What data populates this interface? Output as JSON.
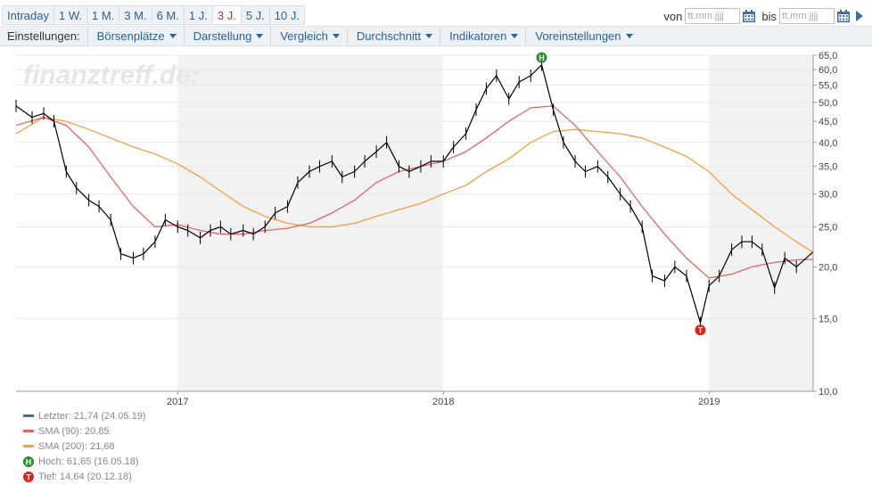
{
  "toolbar": {
    "ranges": [
      "Intraday",
      "1 W.",
      "1 M.",
      "3 M.",
      "6 M.",
      "1 J.",
      "3 J.",
      "5 J.",
      "10 J."
    ],
    "active_range": "3 J.",
    "from_label": "von",
    "to_label": "bis",
    "date_placeholder": "tt.mm.jjjj"
  },
  "settings": {
    "label": "Einstellungen:",
    "menus": [
      "Börsenplätze",
      "Darstellung",
      "Vergleich",
      "Durchschnitt",
      "Indikatoren",
      "Voreinstellungen"
    ]
  },
  "watermark": "finanztreff.de:",
  "colors": {
    "price": "#000000",
    "sma90": "#e06666",
    "sma200": "#f0a040",
    "last": "#3d6fa8",
    "high": "#2e8b2e",
    "low": "#d9251d",
    "shade": "#f2f2f2",
    "grid": "#e8e8e8"
  },
  "legend": [
    {
      "text": "Letzter: 21,74 (24.05.19)",
      "kind": "line",
      "color": "#3d6fa8"
    },
    {
      "text": "SMA (90): 20,85",
      "kind": "line",
      "color": "#e06666"
    },
    {
      "text": "SMA (200): 21,68",
      "kind": "line",
      "color": "#f0a040"
    },
    {
      "text": "Hoch: 61,65 (16.05.18)",
      "kind": "marker",
      "letter": "H",
      "color": "#2e8b2e"
    },
    {
      "text": "Tief: 14,64 (20.12.18)",
      "kind": "marker",
      "letter": "T",
      "color": "#d9251d"
    }
  ],
  "chart_data": {
    "type": "line",
    "y_scale": "log",
    "ylim": [
      10,
      65
    ],
    "yticks": [
      10,
      15,
      20,
      25,
      30,
      35,
      40,
      45,
      50,
      55,
      60,
      65
    ],
    "ytick_labels": [
      "10,0",
      "15,0",
      "20,0",
      "25,0",
      "30,0",
      "35,0",
      "40,0",
      "45,0",
      "50,0",
      "55,0",
      "60,0",
      "65,0"
    ],
    "xlim": [
      "2016-05-24",
      "2019-05-24"
    ],
    "xticks": [
      "2017-01-01",
      "2018-01-01",
      "2019-01-01"
    ],
    "xtick_labels": [
      "2017",
      "2018",
      "2019"
    ],
    "shaded_years": [
      [
        "2017-01-01",
        "2017-12-31"
      ],
      [
        "2019-01-01",
        "2019-05-24"
      ]
    ],
    "grid": true,
    "series": [
      {
        "key": "price",
        "x": [
          "2016-05-24",
          "2016-06-15",
          "2016-07-01",
          "2016-07-15",
          "2016-08-01",
          "2016-08-15",
          "2016-09-01",
          "2016-09-15",
          "2016-10-01",
          "2016-10-15",
          "2016-11-01",
          "2016-11-15",
          "2016-12-01",
          "2016-12-15",
          "2017-01-01",
          "2017-01-15",
          "2017-02-01",
          "2017-02-15",
          "2017-03-01",
          "2017-03-15",
          "2017-04-01",
          "2017-04-15",
          "2017-05-01",
          "2017-05-15",
          "2017-06-01",
          "2017-06-15",
          "2017-07-01",
          "2017-07-15",
          "2017-08-01",
          "2017-08-15",
          "2017-09-01",
          "2017-09-15",
          "2017-10-01",
          "2017-10-15",
          "2017-11-01",
          "2017-11-15",
          "2017-12-01",
          "2017-12-15",
          "2018-01-01",
          "2018-01-15",
          "2018-02-01",
          "2018-02-15",
          "2018-03-01",
          "2018-03-15",
          "2018-04-01",
          "2018-04-15",
          "2018-05-01",
          "2018-05-16",
          "2018-06-01",
          "2018-06-15",
          "2018-07-01",
          "2018-07-15",
          "2018-08-01",
          "2018-08-15",
          "2018-09-01",
          "2018-09-15",
          "2018-10-01",
          "2018-10-15",
          "2018-11-01",
          "2018-11-15",
          "2018-12-01",
          "2018-12-20",
          "2019-01-01",
          "2019-01-15",
          "2019-02-01",
          "2019-02-15",
          "2019-03-01",
          "2019-03-15",
          "2019-04-01",
          "2019-04-15",
          "2019-05-01",
          "2019-05-24"
        ],
        "values": [
          49,
          46,
          47,
          45,
          34,
          31,
          29,
          28,
          26,
          21.5,
          21,
          21.5,
          23,
          26,
          25,
          24.5,
          23.5,
          24.5,
          25,
          24,
          24.5,
          24,
          25,
          27,
          28,
          32,
          34,
          35,
          36,
          33,
          34,
          36,
          38,
          40,
          35,
          34,
          35,
          36,
          36,
          39,
          42,
          48,
          54,
          58,
          51,
          56,
          58,
          61.65,
          48,
          40,
          36,
          34,
          35,
          33,
          30,
          28,
          25,
          19,
          18.5,
          20,
          19,
          14.64,
          18,
          19,
          22,
          23,
          23,
          22,
          17.8,
          21,
          20,
          21.74
        ]
      },
      {
        "key": "sma90",
        "x": [
          "2016-05-24",
          "2016-07-01",
          "2016-08-01",
          "2016-09-01",
          "2016-10-01",
          "2016-11-01",
          "2016-12-01",
          "2017-01-01",
          "2017-02-01",
          "2017-03-01",
          "2017-04-01",
          "2017-05-01",
          "2017-06-01",
          "2017-07-01",
          "2017-08-01",
          "2017-09-01",
          "2017-10-01",
          "2017-11-01",
          "2017-12-01",
          "2018-01-01",
          "2018-02-01",
          "2018-03-01",
          "2018-04-01",
          "2018-05-01",
          "2018-06-01",
          "2018-07-01",
          "2018-08-01",
          "2018-09-01",
          "2018-10-01",
          "2018-11-01",
          "2018-12-01",
          "2019-01-01",
          "2019-02-01",
          "2019-03-01",
          "2019-04-01",
          "2019-05-01",
          "2019-05-24"
        ],
        "values": [
          44,
          46,
          44,
          39,
          33,
          28,
          25,
          25.3,
          24.5,
          24,
          24,
          24.5,
          24.8,
          25.5,
          27,
          29,
          32,
          34,
          35,
          36,
          38,
          41,
          45,
          48.5,
          49,
          44,
          38,
          33,
          28,
          24,
          21,
          18.8,
          19.2,
          20,
          20.5,
          20.8,
          20.85
        ]
      },
      {
        "key": "sma200",
        "x": [
          "2016-05-24",
          "2016-07-01",
          "2016-08-01",
          "2016-09-01",
          "2016-10-01",
          "2016-11-01",
          "2016-12-01",
          "2017-01-01",
          "2017-02-01",
          "2017-03-01",
          "2017-04-01",
          "2017-05-01",
          "2017-06-01",
          "2017-07-01",
          "2017-08-01",
          "2017-09-01",
          "2017-10-01",
          "2017-11-01",
          "2017-12-01",
          "2018-01-01",
          "2018-02-01",
          "2018-03-01",
          "2018-04-01",
          "2018-05-01",
          "2018-06-01",
          "2018-07-01",
          "2018-08-01",
          "2018-09-01",
          "2018-10-01",
          "2018-11-01",
          "2018-12-01",
          "2019-01-01",
          "2019-02-01",
          "2019-03-01",
          "2019-04-01",
          "2019-05-01",
          "2019-05-24"
        ],
        "values": [
          42,
          46,
          45,
          43,
          41,
          39,
          37.5,
          35.5,
          33,
          30.5,
          28,
          26.5,
          25.5,
          25,
          25,
          25.5,
          26.5,
          27.5,
          28.5,
          30,
          31.5,
          34,
          36.5,
          40,
          42.5,
          43,
          42.5,
          42,
          41,
          39,
          37,
          34,
          30,
          27.5,
          25,
          23,
          21.68
        ]
      }
    ],
    "markers": [
      {
        "letter": "H",
        "date": "2018-05-16",
        "value": 61.65
      },
      {
        "letter": "T",
        "date": "2018-12-20",
        "value": 14.64
      }
    ]
  }
}
